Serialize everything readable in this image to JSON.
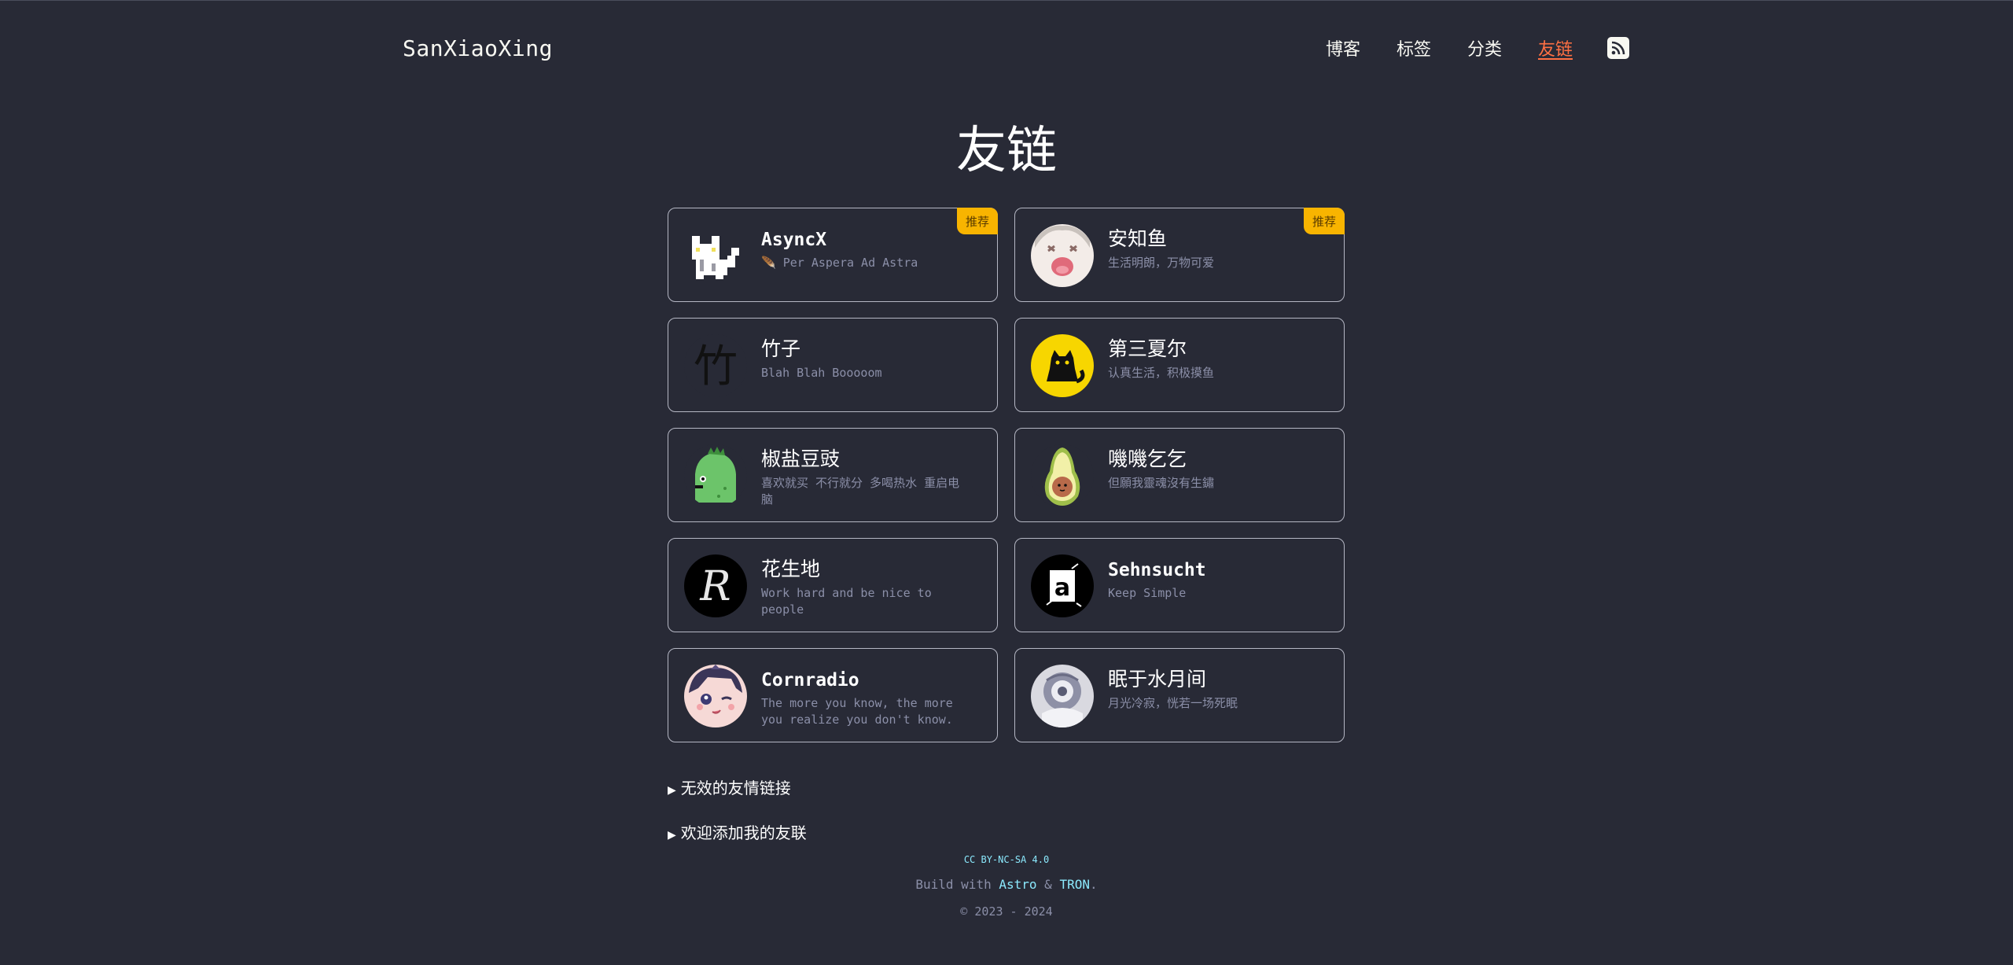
{
  "site": {
    "logo": "SanXiaoXing"
  },
  "nav": {
    "items": [
      {
        "label": "博客"
      },
      {
        "label": "标签"
      },
      {
        "label": "分类"
      },
      {
        "label": "友链"
      }
    ],
    "rss_icon": "rss-icon"
  },
  "page": {
    "title": "友链"
  },
  "links": [
    {
      "name": "AsyncX",
      "desc": "🪶 Per Aspera Ad Astra",
      "badge": "推荐",
      "avatar": "pixel-cat"
    },
    {
      "name": "安知鱼",
      "desc": "生活明朗，万物可爱",
      "badge": "推荐",
      "avatar": "anime-face"
    },
    {
      "name": "竹子",
      "desc": "Blah Blah Booooom",
      "avatar": "bamboo-character"
    },
    {
      "name": "第三夏尔",
      "desc": "认真生活，积极摸鱼",
      "avatar": "black-cat-yellow"
    },
    {
      "name": "椒盐豆豉",
      "desc": "喜欢就买 不行就分 多喝热水 重启电脑",
      "avatar": "green-dino"
    },
    {
      "name": "嘰嘰乞乞",
      "desc": "但願我靈魂沒有生鏽",
      "avatar": "avocado"
    },
    {
      "name": "花生地",
      "desc": "Work hard and be nice to people",
      "avatar": "letter-r"
    },
    {
      "name": "Sehnsucht",
      "desc": "Keep Simple",
      "avatar": "ink-logo"
    },
    {
      "name": "Cornradio",
      "desc": "The more you know, the more you realize you don't know.",
      "avatar": "anime-wink"
    },
    {
      "name": "眠于水月间",
      "desc": "月光冷寂，恍若一场死眠",
      "avatar": "anime-gray"
    }
  ],
  "sections": {
    "invalid_links": "无效的友情链接",
    "add_me": "欢迎添加我的友联"
  },
  "footer": {
    "license": "CC BY-NC-SA 4.0",
    "build_prefix": "Build with",
    "astro": "Astro",
    "amp": "&",
    "tron": "TRON",
    "period": ".",
    "copyright": "© 2023 - 2024"
  },
  "colors": {
    "background": "#282a36",
    "accent": "#ff7043",
    "badge": "#f8b400",
    "link": "#8be9fd"
  }
}
